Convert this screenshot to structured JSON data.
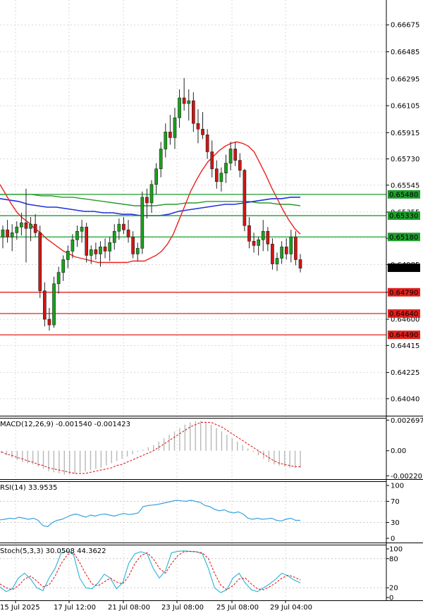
{
  "chart_data": [
    {
      "type": "candlestick",
      "panel": "main",
      "ylim": [
        0.6392,
        0.6685
      ],
      "price_ticks": [
        "0.66675",
        "0.66485",
        "0.66295",
        "0.66105",
        "0.65915",
        "0.65730",
        "0.65545",
        "0.65355",
        "0.65170",
        "0.64985",
        "0.64790",
        "0.64600",
        "0.64415",
        "0.64225",
        "0.64040"
      ],
      "time_labels": [
        "15 Jul 2025",
        "17 Jul 12:00",
        "21 Jul 08:00",
        "23 Jul 08:00",
        "25 Jul 08:00",
        "29 Jul 04:00"
      ],
      "current_price": "0.64963",
      "levels": [
        {
          "price": 0.6548,
          "label": "0.65480",
          "color": "#1e9e2e"
        },
        {
          "price": 0.6533,
          "label": "0.65330",
          "color": "#1e9e2e"
        },
        {
          "price": 0.6518,
          "label": "0.65180",
          "color": "#1e9e2e"
        },
        {
          "price": 0.6479,
          "label": "0.64790",
          "color": "#e0201c"
        },
        {
          "price": 0.6464,
          "label": "0.64640",
          "color": "#e0201c"
        },
        {
          "price": 0.6449,
          "label": "0.64490",
          "color": "#e0201c"
        }
      ],
      "candles": [
        [
          0.6518,
          0.6526,
          0.651,
          0.6523
        ],
        [
          0.6523,
          0.653,
          0.6514,
          0.6518
        ],
        [
          0.6518,
          0.6527,
          0.6508,
          0.6521
        ],
        [
          0.6521,
          0.6529,
          0.6516,
          0.6525
        ],
        [
          0.6525,
          0.6535,
          0.6519,
          0.6528
        ],
        [
          0.6528,
          0.6552,
          0.65,
          0.6524
        ],
        [
          0.6524,
          0.6532,
          0.6515,
          0.6527
        ],
        [
          0.6527,
          0.6534,
          0.6518,
          0.6521
        ],
        [
          0.6521,
          0.6526,
          0.6475,
          0.648
        ],
        [
          0.648,
          0.6486,
          0.6455,
          0.646
        ],
        [
          0.646,
          0.6468,
          0.6452,
          0.6456
        ],
        [
          0.6456,
          0.649,
          0.6454,
          0.6485
        ],
        [
          0.6485,
          0.6497,
          0.6478,
          0.6493
        ],
        [
          0.6493,
          0.6505,
          0.6487,
          0.6502
        ],
        [
          0.6502,
          0.6512,
          0.6496,
          0.6508
        ],
        [
          0.6508,
          0.652,
          0.6503,
          0.6516
        ],
        [
          0.6516,
          0.6526,
          0.6511,
          0.6522
        ],
        [
          0.6522,
          0.653,
          0.6514,
          0.6525
        ],
        [
          0.6525,
          0.6528,
          0.65,
          0.6505
        ],
        [
          0.6505,
          0.6512,
          0.6499,
          0.6509
        ],
        [
          0.6509,
          0.6514,
          0.6502,
          0.6506
        ],
        [
          0.6506,
          0.6515,
          0.6497,
          0.6511
        ],
        [
          0.6511,
          0.6517,
          0.6503,
          0.6508
        ],
        [
          0.6508,
          0.6518,
          0.6501,
          0.6514
        ],
        [
          0.6514,
          0.6527,
          0.6509,
          0.6522
        ],
        [
          0.6522,
          0.6531,
          0.6516,
          0.6527
        ],
        [
          0.6527,
          0.6532,
          0.652,
          0.6523
        ],
        [
          0.6523,
          0.653,
          0.6514,
          0.6518
        ],
        [
          0.6518,
          0.6522,
          0.6503,
          0.6506
        ],
        [
          0.6506,
          0.6514,
          0.6501,
          0.651
        ],
        [
          0.651,
          0.655,
          0.6506,
          0.6546
        ],
        [
          0.6546,
          0.6552,
          0.6531,
          0.6542
        ],
        [
          0.6542,
          0.6558,
          0.6535,
          0.6555
        ],
        [
          0.6555,
          0.657,
          0.6548,
          0.6566
        ],
        [
          0.6566,
          0.6585,
          0.656,
          0.658
        ],
        [
          0.658,
          0.6598,
          0.6574,
          0.6592
        ],
        [
          0.6592,
          0.6604,
          0.6583,
          0.6588
        ],
        [
          0.6588,
          0.6609,
          0.658,
          0.6602
        ],
        [
          0.6602,
          0.6622,
          0.6595,
          0.6616
        ],
        [
          0.6616,
          0.663,
          0.6607,
          0.6612
        ],
        [
          0.6612,
          0.6622,
          0.66,
          0.6614
        ],
        [
          0.6614,
          0.662,
          0.6592,
          0.6598
        ],
        [
          0.6598,
          0.6608,
          0.6584,
          0.6594
        ],
        [
          0.6594,
          0.6606,
          0.6587,
          0.659
        ],
        [
          0.659,
          0.6594,
          0.6573,
          0.6578
        ],
        [
          0.6578,
          0.6586,
          0.656,
          0.6566
        ],
        [
          0.6566,
          0.6572,
          0.6552,
          0.6557
        ],
        [
          0.6557,
          0.6567,
          0.655,
          0.6563
        ],
        [
          0.6563,
          0.6576,
          0.6556,
          0.657
        ],
        [
          0.657,
          0.6585,
          0.6565,
          0.658
        ],
        [
          0.658,
          0.6585,
          0.6568,
          0.6572
        ],
        [
          0.6572,
          0.6577,
          0.656,
          0.6565
        ],
        [
          0.6565,
          0.6566,
          0.6522,
          0.6526
        ],
        [
          0.6526,
          0.6532,
          0.651,
          0.6515
        ],
        [
          0.6515,
          0.6521,
          0.6507,
          0.6512
        ],
        [
          0.6512,
          0.6518,
          0.6505,
          0.6516
        ],
        [
          0.6516,
          0.653,
          0.6508,
          0.6522
        ],
        [
          0.6522,
          0.6525,
          0.6508,
          0.6513
        ],
        [
          0.6513,
          0.6517,
          0.6495,
          0.6499
        ],
        [
          0.6499,
          0.6507,
          0.6494,
          0.6503
        ],
        [
          0.6503,
          0.6515,
          0.6499,
          0.6511
        ],
        [
          0.6511,
          0.6517,
          0.6502,
          0.6506
        ],
        [
          0.6506,
          0.6523,
          0.65,
          0.6518
        ],
        [
          0.6518,
          0.6522,
          0.6498,
          0.6502
        ],
        [
          0.6502,
          0.6506,
          0.6493,
          0.6496
        ]
      ],
      "ma_red": [
        0.6555,
        0.6548,
        0.6541,
        0.6535,
        0.6531,
        0.6528,
        0.6524,
        0.6521,
        0.6517,
        0.6514,
        0.6511,
        0.6508,
        0.6506,
        0.6504,
        0.6503,
        0.6502,
        0.6501,
        0.65,
        0.65,
        0.65,
        0.65,
        0.65,
        0.65,
        0.6501,
        0.6501,
        0.6501,
        0.6503,
        0.6505,
        0.6508,
        0.6513,
        0.652,
        0.653,
        0.654,
        0.655,
        0.6558,
        0.6565,
        0.6571,
        0.6575,
        0.6579,
        0.6582,
        0.6584,
        0.6585,
        0.6584,
        0.6582,
        0.6578,
        0.657,
        0.6562,
        0.6553,
        0.6545,
        0.6537,
        0.653,
        0.6524,
        0.652
      ],
      "ma_blue": [
        0.6545,
        0.6544,
        0.6543,
        0.6541,
        0.654,
        0.6539,
        0.6539,
        0.6538,
        0.6537,
        0.6536,
        0.6536,
        0.6535,
        0.6535,
        0.6534,
        0.6534,
        0.6533,
        0.6533,
        0.6533,
        0.6534,
        0.6536,
        0.6537,
        0.6538,
        0.6539,
        0.654,
        0.6541,
        0.6541,
        0.6542,
        0.6543,
        0.6544,
        0.6545,
        0.6545,
        0.6546,
        0.6546
      ],
      "ma_green": [
        0.6548,
        0.6548,
        0.6548,
        0.6548,
        0.6547,
        0.6547,
        0.6546,
        0.6546,
        0.6545,
        0.6544,
        0.6543,
        0.6542,
        0.6541,
        0.654,
        0.654,
        0.654,
        0.6541,
        0.6541,
        0.6542,
        0.6542,
        0.6543,
        0.6543,
        0.6543,
        0.6543,
        0.6543,
        0.6542,
        0.6542,
        0.6541,
        0.6541,
        0.654
      ]
    },
    {
      "type": "histogram-line",
      "panel": "macd",
      "title": "MACD(12,26,9) -0.001540 -0.001423",
      "ylim": [
        -0.0025,
        0.0029
      ],
      "ticks": [
        "0.002697",
        "0.00",
        "-0.002207"
      ],
      "histogram": [
        -0.0002,
        -0.0004,
        -0.0006,
        -0.0008,
        -0.001,
        -0.0011,
        -0.0012,
        -0.0014,
        -0.0016,
        -0.0018,
        -0.0019,
        -0.002,
        -0.0021,
        -0.0021,
        -0.002,
        -0.0019,
        -0.0018,
        -0.0017,
        -0.0016,
        -0.0015,
        -0.0013,
        -0.0011,
        -0.0009,
        -0.0007,
        -0.0005,
        -0.0003,
        -0.0001,
        0.0001,
        0.0003,
        0.0005,
        0.0008,
        0.0011,
        0.0014,
        0.0017,
        0.002,
        0.0023,
        0.0025,
        0.0026,
        0.0026,
        0.0025,
        0.0023,
        0.002,
        0.0017,
        0.0014,
        0.0011,
        0.0008,
        0.0005,
        0.0002,
        -0.0001,
        -0.0004,
        -0.0007,
        -0.001,
        -0.0012,
        -0.0013,
        -0.0014,
        -0.0015,
        -0.0015,
        -0.0015
      ],
      "signal": [
        -0.0001,
        -0.0003,
        -0.0004,
        -0.0006,
        -0.0007,
        -0.0009,
        -0.001,
        -0.0012,
        -0.0013,
        -0.0015,
        -0.0016,
        -0.0017,
        -0.0018,
        -0.0019,
        -0.002,
        -0.002,
        -0.002,
        -0.0019,
        -0.0018,
        -0.0017,
        -0.0016,
        -0.0015,
        -0.0013,
        -0.0012,
        -0.001,
        -0.0008,
        -0.0006,
        -0.0004,
        -0.0002,
        0.0,
        0.0003,
        0.0006,
        0.0009,
        0.0012,
        0.0015,
        0.0018,
        0.0021,
        0.0023,
        0.0025,
        0.0025,
        0.0025,
        0.0023,
        0.0021,
        0.0018,
        0.0015,
        0.0012,
        0.0009,
        0.0006,
        0.0003,
        0.0,
        -0.0003,
        -0.0006,
        -0.0009,
        -0.0011,
        -0.0012,
        -0.0013,
        -0.0014,
        -0.0014
      ]
    },
    {
      "type": "line",
      "panel": "rsi",
      "title": "RSI(14) 33.9535",
      "ylim": [
        0,
        100
      ],
      "ticks": [
        "100",
        "70",
        "30",
        "0"
      ],
      "values": [
        35,
        36,
        38,
        37,
        40,
        38,
        36,
        38,
        34,
        24,
        22,
        30,
        34,
        36,
        40,
        44,
        46,
        43,
        40,
        44,
        42,
        45,
        46,
        44,
        42,
        45,
        47,
        45,
        46,
        48,
        60,
        62,
        63,
        64,
        66,
        68,
        70,
        72,
        71,
        70,
        72,
        70,
        68,
        62,
        60,
        55,
        52,
        54,
        50,
        48,
        50,
        46,
        38,
        36,
        38,
        36,
        37,
        38,
        34,
        33,
        36,
        38,
        34,
        34
      ],
      "levels": [
        70,
        30
      ]
    },
    {
      "type": "line",
      "panel": "stoch",
      "title": "Stoch(5,3,3) 30.0508 44.3622",
      "ylim": [
        0,
        100
      ],
      "ticks": [
        "100",
        "80",
        "20",
        "0"
      ],
      "k": [
        22,
        12,
        18,
        40,
        50,
        38,
        20,
        14,
        40,
        60,
        92,
        96,
        88,
        40,
        20,
        18,
        30,
        48,
        40,
        18,
        30,
        70,
        90,
        94,
        90,
        60,
        40,
        55,
        92,
        95,
        96,
        95,
        94,
        90,
        60,
        20,
        10,
        16,
        40,
        50,
        30,
        16,
        12,
        20,
        28,
        38,
        50,
        44,
        36,
        30
      ],
      "d": [
        28,
        20,
        16,
        24,
        38,
        44,
        34,
        22,
        26,
        44,
        70,
        88,
        92,
        72,
        48,
        28,
        24,
        32,
        40,
        32,
        28,
        44,
        70,
        86,
        92,
        80,
        60,
        50,
        70,
        86,
        94,
        95,
        94,
        92,
        80,
        50,
        26,
        16,
        24,
        38,
        40,
        28,
        18,
        16,
        22,
        30,
        40,
        46,
        42,
        36
      ],
      "levels": [
        80,
        20
      ]
    }
  ]
}
